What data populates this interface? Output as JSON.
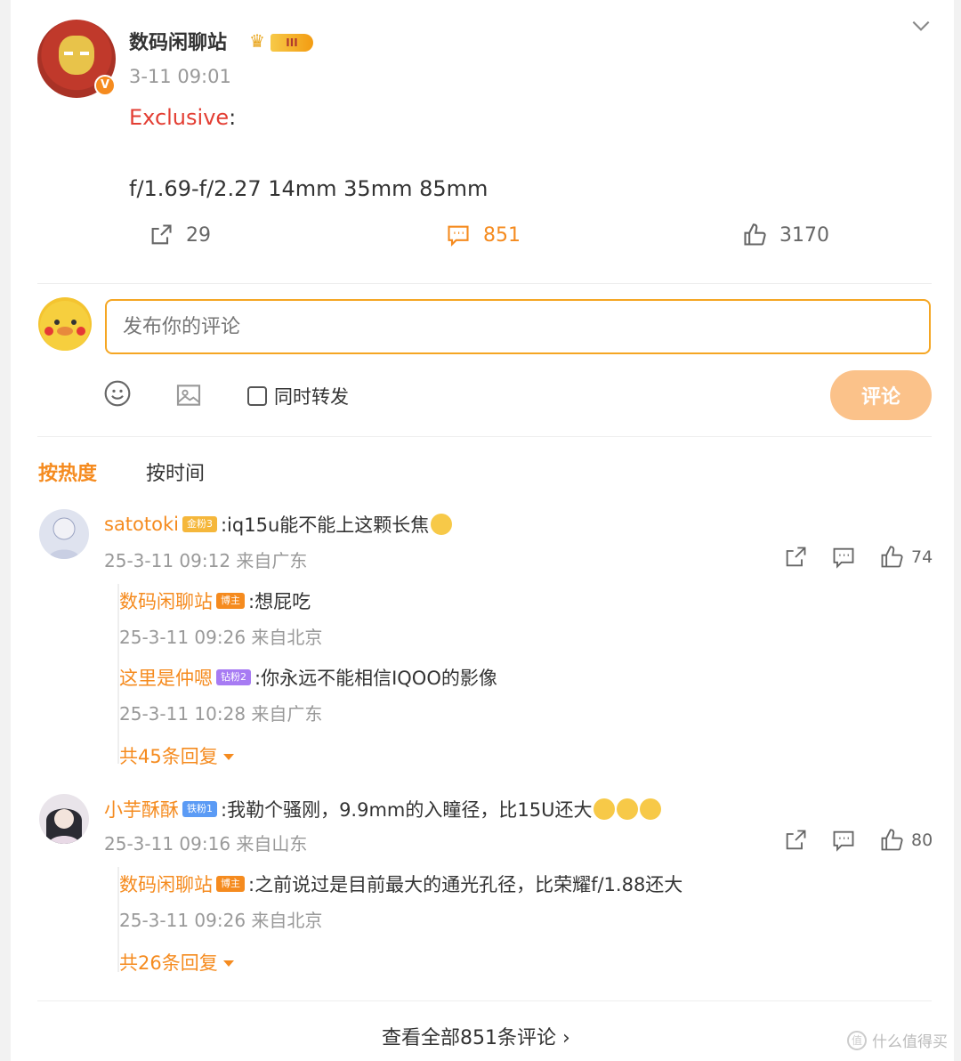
{
  "post": {
    "author": "数码闲聊站",
    "level_badge": "III",
    "time": "3-11 09:01",
    "exclusive_label": "Exclusive",
    "exclusive_colon": ":",
    "body": "f/1.69-f/2.27 14mm 35mm 85mm",
    "stats": {
      "shares": "29",
      "comments": "851",
      "likes": "3170"
    }
  },
  "composer": {
    "placeholder": "发布你的评论",
    "repost_label": "同时转发",
    "submit_label": "评论"
  },
  "sort": {
    "hot": "按热度",
    "time": "按时间"
  },
  "comments": [
    {
      "name": "satotoki",
      "badge": "金粉3",
      "text": ":iq15u能不能上这颗长焦",
      "meta": "25-3-11 09:12 来自广东",
      "likes": "74",
      "replies": [
        {
          "name": "数码闲聊站",
          "badge": "博主",
          "text": ":想屁吃",
          "meta": "25-3-11 09:26 来自北京"
        },
        {
          "name": "这里是仲嗯",
          "badge": "钻粉2",
          "text": ":你永远不能相信IQOO的影像",
          "meta": "25-3-11 10:28 来自广东"
        }
      ],
      "more": "共45条回复"
    },
    {
      "name": "小芋酥酥",
      "badge": "铁粉1",
      "text": ":我勒个骚刚，9.9mm的入瞳径，比15U还大",
      "meta": "25-3-11 09:16 来自山东",
      "likes": "80",
      "replies": [
        {
          "name": "数码闲聊站",
          "badge": "博主",
          "text": ":之前说过是目前最大的通光孔径，比荣耀f/1.88还大",
          "meta": "25-3-11 09:26 来自北京"
        }
      ],
      "more": "共26条回复"
    }
  ],
  "footer": {
    "view_all": "查看全部851条评论 ›",
    "watermark": "什么值得买",
    "watermark_mark": "值"
  },
  "colors": {
    "accent": "#f58b1f",
    "submit_disabled": "#fbc28a",
    "red": "#e33e33"
  }
}
